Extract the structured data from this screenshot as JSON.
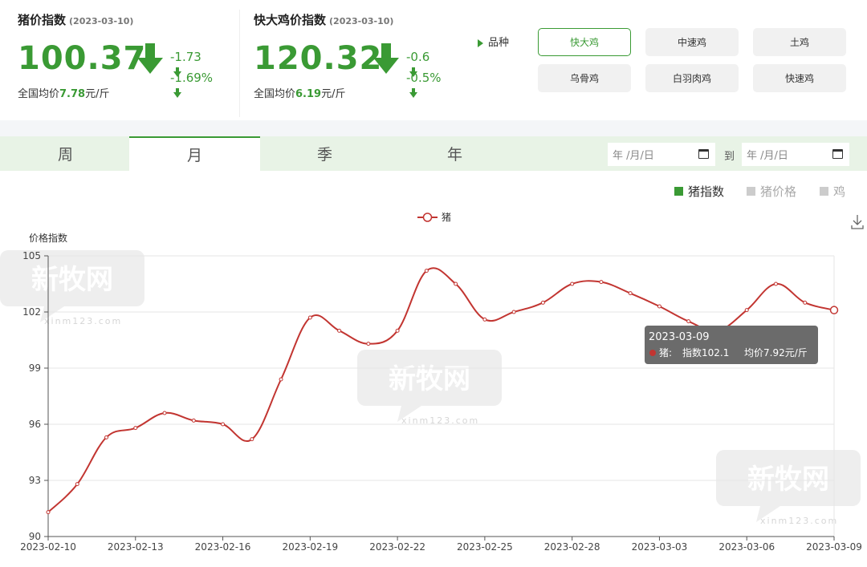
{
  "cards": [
    {
      "title": "猪价指数",
      "date": "(2023-03-10)",
      "value": "100.37",
      "change_abs": "-1.73",
      "change_pct": "-1.69%",
      "avg_label": "全国均价",
      "avg_value": "7.78",
      "avg_unit": "元/斤"
    },
    {
      "title": "快大鸡价指数",
      "date": "(2023-03-10)",
      "value": "120.32",
      "change_abs": "-0.6",
      "change_pct": "-0.5%",
      "avg_label": "全国均价",
      "avg_value": "6.19",
      "avg_unit": "元/斤"
    }
  ],
  "variety_label": "品种",
  "variety_buttons": [
    "快大鸡",
    "中速鸡",
    "土鸡",
    "乌骨鸡",
    "白羽肉鸡",
    "快速鸡"
  ],
  "variety_active": "快大鸡",
  "tabs": [
    "周",
    "月",
    "季",
    "年"
  ],
  "active_tab": "月",
  "date_from_placeholder": "年 /月/日",
  "date_to_placeholder": "年 /月/日",
  "date_to_label": "到",
  "legend_switches": [
    {
      "label": "猪指数",
      "active": true
    },
    {
      "label": "猪价格",
      "active": false
    },
    {
      "label": "鸡",
      "active": false
    }
  ],
  "watermark_text": "新牧网",
  "watermark_url": "xinm123.com",
  "colors": {
    "green": "#3a9a34",
    "line": "#c23531",
    "tooltip_bg": "#6b6b6b"
  },
  "chart_data": {
    "type": "line",
    "legend": [
      "猪"
    ],
    "ylabel": "价格指数",
    "ylim": [
      90,
      105
    ],
    "yticks": [
      90,
      93,
      96,
      99,
      102,
      105
    ],
    "x": [
      "2023-02-10",
      "2023-02-11",
      "2023-02-12",
      "2023-02-13",
      "2023-02-14",
      "2023-02-15",
      "2023-02-16",
      "2023-02-17",
      "2023-02-18",
      "2023-02-19",
      "2023-02-20",
      "2023-02-21",
      "2023-02-22",
      "2023-02-23",
      "2023-02-24",
      "2023-02-25",
      "2023-02-26",
      "2023-02-27",
      "2023-02-28",
      "2023-03-01",
      "2023-03-02",
      "2023-03-03",
      "2023-03-04",
      "2023-03-05",
      "2023-03-06",
      "2023-03-07",
      "2023-03-08",
      "2023-03-09"
    ],
    "xtick_labels": [
      "2023-02-10",
      "2023-02-13",
      "2023-02-16",
      "2023-02-19",
      "2023-02-22",
      "2023-02-25",
      "2023-02-28",
      "2023-03-03",
      "2023-03-06",
      "2023-03-09"
    ],
    "series": [
      {
        "name": "猪",
        "values": [
          91.3,
          92.8,
          95.3,
          95.8,
          96.6,
          96.2,
          96.0,
          95.2,
          98.4,
          101.7,
          101.0,
          100.3,
          101.0,
          104.2,
          103.5,
          101.6,
          102.0,
          102.5,
          103.5,
          103.6,
          103.0,
          102.3,
          101.5,
          101.0,
          102.1,
          103.5,
          102.5,
          102.1
        ]
      }
    ],
    "tooltip": {
      "date": "2023-03-09",
      "series": "猪:",
      "index_text": "指数102.1",
      "avg_text": "均价7.92元/斤"
    }
  }
}
